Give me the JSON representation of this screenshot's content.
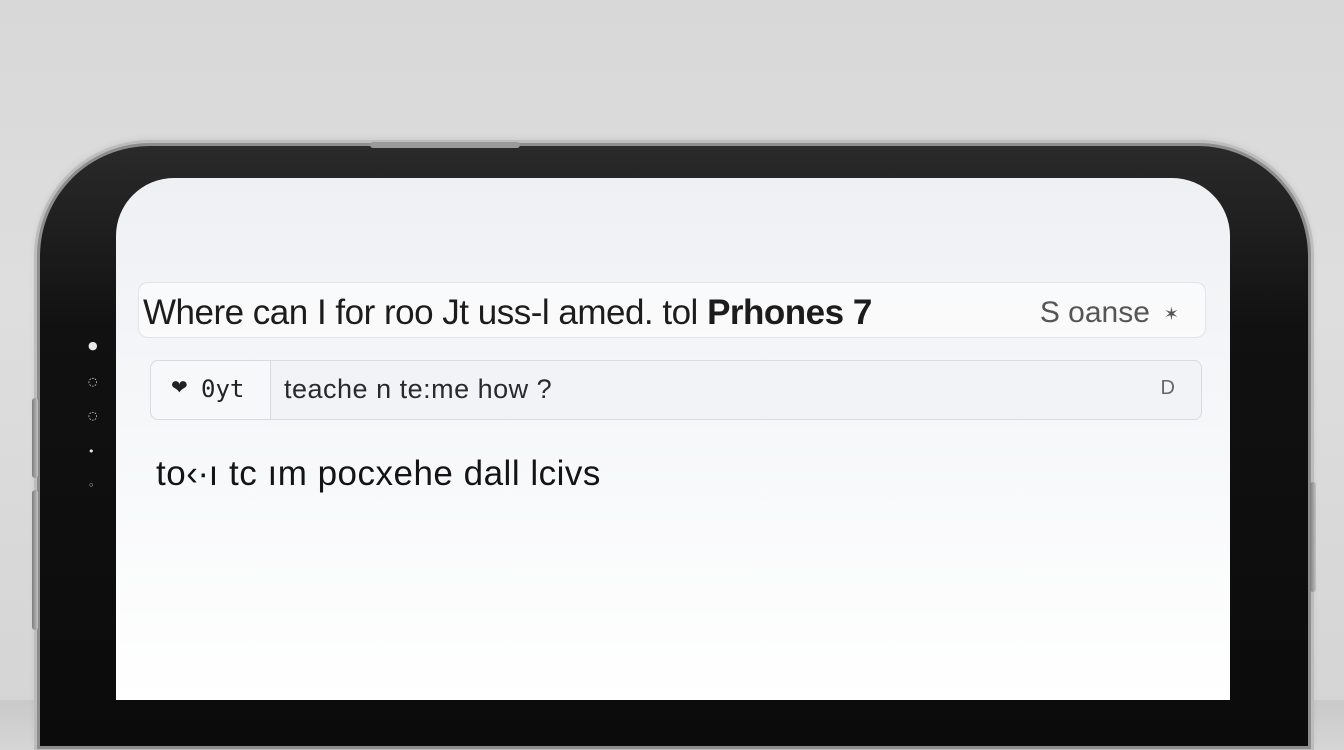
{
  "search": {
    "query_plain": "Where can I  for roo Jt uss-l amed. tol ",
    "query_bold": "Prhones 7",
    "button_label": "S oanse",
    "button_glyph": "✶"
  },
  "filter": {
    "chip_icon": "❤",
    "chip_label": "0yt",
    "text": "teache  n  te:me  how ?",
    "end_icon": "D"
  },
  "result": {
    "text": "to‹∙ı tc  ım pocxehe dall lcivs"
  },
  "icons": {
    "chip_icon_name": "heart-icon",
    "end_icon_name": "mic-icon"
  }
}
